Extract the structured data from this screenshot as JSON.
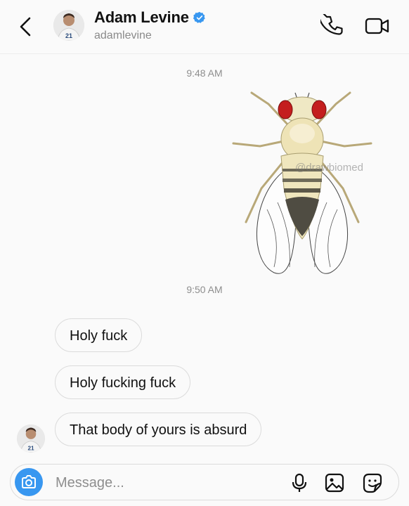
{
  "header": {
    "display_name": "Adam Levine",
    "username": "adamlevine",
    "verified": true,
    "icons": {
      "back": "chevron-left-icon",
      "call": "phone-icon",
      "video": "video-camera-icon"
    }
  },
  "thread": {
    "timestamps": [
      "9:48 AM",
      "9:50 AM"
    ],
    "image": {
      "subject": "fruit-fly-illustration",
      "watermark": "@drawbiomed"
    },
    "messages": [
      "Holy fuck",
      "Holy fucking fuck",
      "That body of yours is absurd"
    ]
  },
  "composer": {
    "placeholder": "Message...",
    "value": "",
    "icons": [
      "camera-icon",
      "microphone-icon",
      "gallery-icon",
      "sticker-icon"
    ]
  },
  "colors": {
    "accent": "#3897f0",
    "verified": "#3897f0",
    "fly_eye": "#c41e1e"
  }
}
